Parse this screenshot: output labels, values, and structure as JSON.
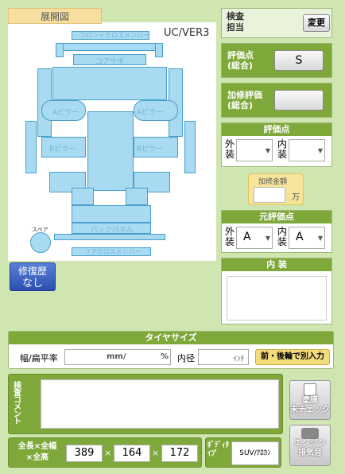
{
  "diagram": {
    "tab_label": "展開図",
    "version": "UC/VER3",
    "labels": {
      "front_cross": "フロントクロスメンバー",
      "core_support": "コアサポ",
      "a_pillar_l": "Aピラー",
      "a_pillar_r": "Aピラー",
      "b_pillar_l": "Bピラー",
      "b_pillar_r": "Bピラー",
      "back_panel": "バックパネル",
      "rear_cross": "リアクロスメンバー",
      "spare": "スペア"
    }
  },
  "repair_history": {
    "label": "修復歴",
    "value": "なし"
  },
  "inspector": {
    "label": "検査\n担当",
    "change_button": "変更"
  },
  "overall_score": {
    "label": "評価点\n(総合)",
    "value": "S"
  },
  "repair_overall": {
    "label": "加修評価\n(総合)",
    "value": ""
  },
  "score": {
    "title": "評価点",
    "exterior_label": "外\n装",
    "interior_label": "内\n装",
    "exterior_value": "",
    "interior_value": ""
  },
  "repair_amount": {
    "label": "加修金額",
    "value": "",
    "unit": "万"
  },
  "original_score": {
    "title": "元評価点",
    "exterior_label": "外\n装",
    "interior_label": "内\n装",
    "exterior_value": "A",
    "interior_value": "A"
  },
  "interior": {
    "title": "内 装",
    "value": ""
  },
  "tire": {
    "title": "タイヤサイズ",
    "width_label": "幅/扁平率",
    "mm_unit": "mm/",
    "pct_unit": "%",
    "inner_label": "内径",
    "inch_unit": "ｲﾝﾁ",
    "split_button": "前・後輪で別入力"
  },
  "comment": {
    "label": "検\n査\nコ\nメ\nン\nト",
    "value": ""
  },
  "paint_button": {
    "label": "塗膜\n未チェック"
  },
  "engine_button": {
    "label": "エンジン\n排気音"
  },
  "dimensions": {
    "label": "全長×全幅\n×全高",
    "length": "389",
    "width": "164",
    "height": "172",
    "sep1": "×",
    "sep2": "×"
  },
  "body_type": {
    "label": "ﾎﾞﾃﾞｨﾀｲﾌﾟ",
    "value": "SUV/ｸﾛｶﾝ"
  }
}
